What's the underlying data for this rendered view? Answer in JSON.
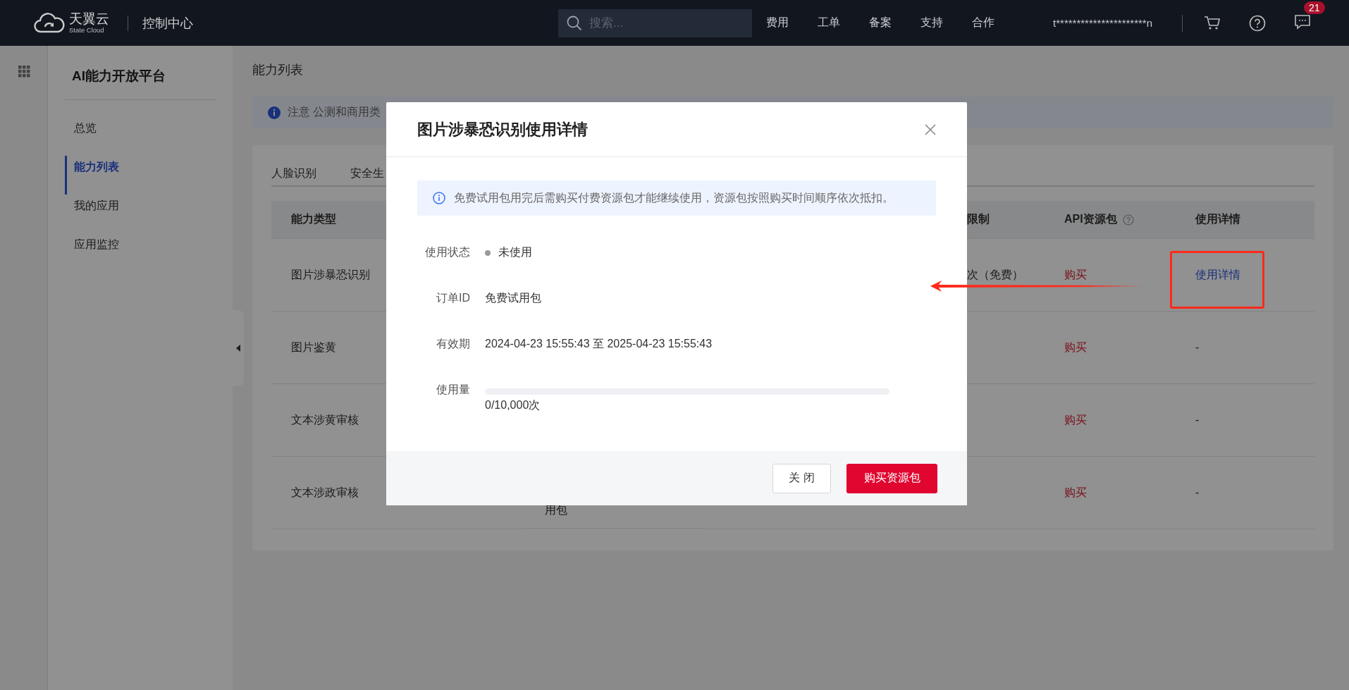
{
  "topbar": {
    "logo_text": "天翼云",
    "logo_subtext": "State Cloud",
    "console": "控制中心",
    "search": {
      "placeholder": "搜索..."
    },
    "nav": [
      "费用",
      "工单",
      "备案",
      "支持",
      "合作"
    ],
    "user": "t**********************n",
    "notification_count": "21"
  },
  "sidebar": {
    "title": "AI能力开放平台",
    "items": [
      {
        "label": "总览",
        "selected": false
      },
      {
        "label": "能力列表",
        "selected": true
      },
      {
        "label": "我的应用",
        "selected": false
      },
      {
        "label": "应用监控",
        "selected": false
      }
    ]
  },
  "page_title": "能力列表",
  "notice": "注意 公测和商用类",
  "tabs": [
    {
      "label": "人脸识别",
      "selected": false
    },
    {
      "label": "安全生",
      "selected": false
    }
  ],
  "table": {
    "headers": {
      "ability": "能力类型",
      "limit": "限制",
      "api_package": "API资源包",
      "usage": "使用详情"
    },
    "rows": [
      {
        "ability": "图片涉暴恐识别",
        "limit": "次（免费）",
        "api_package": "购买",
        "usage": {
          "kind": "link",
          "text": "使用详情"
        }
      },
      {
        "ability": "图片鉴黄",
        "api_package": "购买",
        "usage": {
          "kind": "text",
          "text": "-"
        }
      },
      {
        "ability": "文本涉黄审核",
        "api_package": "购买",
        "usage": {
          "kind": "text",
          "text": "-"
        }
      },
      {
        "ability": "文本涉政审核",
        "column_2": "用包",
        "api_package": "购买",
        "usage": {
          "kind": "text",
          "text": "-"
        }
      }
    ]
  },
  "modal": {
    "title": "图片涉暴恐识别使用详情",
    "info": "免费试用包用完后需购买付费资源包才能继续使用，资源包按照购买时间顺序依次抵扣。",
    "fields": [
      {
        "kind": "status",
        "label": "使用状态",
        "value": "未使用"
      },
      {
        "kind": "text",
        "label": "订单ID",
        "value": "免费试用包"
      },
      {
        "kind": "text",
        "label": "有效期",
        "value": "2024-04-23 15:55:43 至 2025-04-23 15:55:43"
      },
      {
        "kind": "progress",
        "label": "使用量",
        "level": 0,
        "value": "0/10,000次"
      }
    ],
    "buttons": [
      {
        "kind": "secondary",
        "label": "关 闭"
      },
      {
        "kind": "primary",
        "label": "购买资源包"
      }
    ]
  }
}
